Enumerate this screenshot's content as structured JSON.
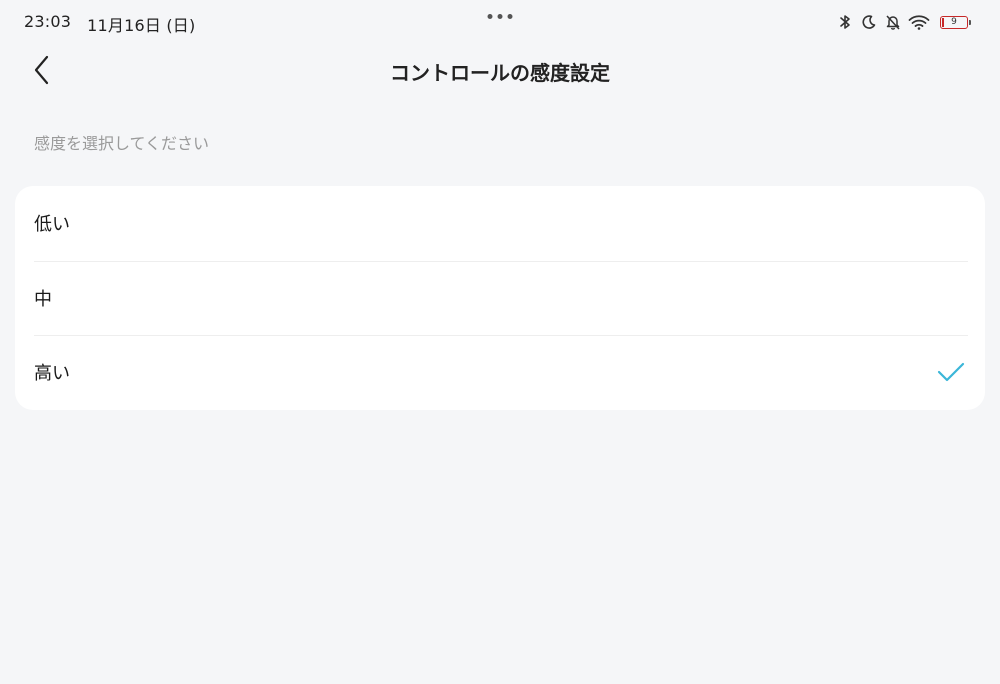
{
  "status_bar": {
    "time": "23:03",
    "date": "11月16日 (日)",
    "battery_level": "9",
    "icons": [
      "bluetooth-icon",
      "moon-icon",
      "bell-off-icon",
      "wifi-icon",
      "battery-icon"
    ]
  },
  "header": {
    "title": "コントロールの感度設定",
    "back_icon": "chevron-left-icon"
  },
  "section": {
    "label": "感度を選択してください"
  },
  "options": [
    {
      "label": "低い",
      "selected": false
    },
    {
      "label": "中",
      "selected": false
    },
    {
      "label": "高い",
      "selected": true
    }
  ],
  "colors": {
    "background": "#f5f6f8",
    "card": "#ffffff",
    "accent": "#3bb6d8",
    "battery_low": "#c62828"
  }
}
